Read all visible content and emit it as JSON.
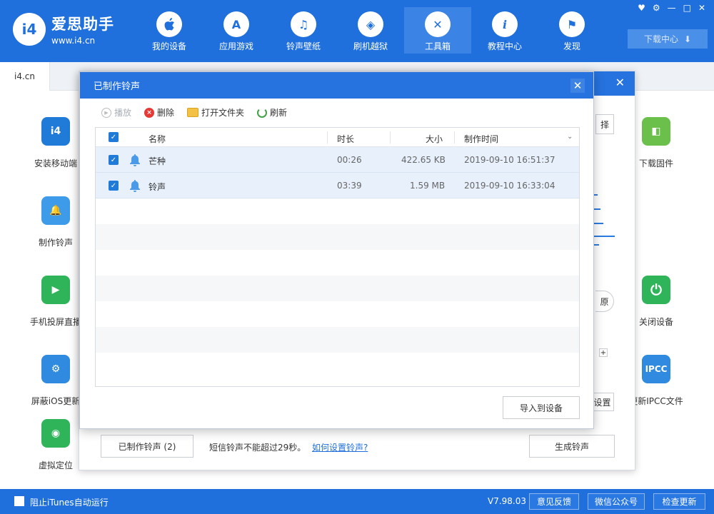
{
  "app": {
    "brand_name": "爱思助手",
    "brand_url": "www.i4.cn",
    "logo_mark": "i4"
  },
  "nav": [
    {
      "label": "我的设备",
      "icon": "apple-icon",
      "glyph": ""
    },
    {
      "label": "应用游戏",
      "icon": "app-store-icon",
      "glyph": "A"
    },
    {
      "label": "铃声壁纸",
      "icon": "music-icon",
      "glyph": "♫"
    },
    {
      "label": "刷机越狱",
      "icon": "dropbox-icon",
      "glyph": "◈"
    },
    {
      "label": "工具箱",
      "icon": "tools-icon",
      "glyph": "✕"
    },
    {
      "label": "教程中心",
      "icon": "info-icon",
      "glyph": "i"
    },
    {
      "label": "发现",
      "icon": "flag-icon",
      "glyph": "⚑"
    }
  ],
  "window_controls": [
    "♥",
    "⚙",
    "—",
    "□",
    "✕"
  ],
  "download_center": "下载中心",
  "tab": "i4.cn",
  "bg_tools_left": [
    {
      "label": "安装移动端",
      "glyph": "i4",
      "color": "#1f7ad8"
    },
    {
      "label": "制作铃声",
      "glyph": "🔔",
      "color": "#3d9be9"
    },
    {
      "label": "手机投屏直播",
      "glyph": "▶",
      "color": "#2fb45a"
    },
    {
      "label": "屏蔽iOS更新",
      "glyph": "⚙",
      "color": "#2f8ae0"
    },
    {
      "label": "虚拟定位",
      "glyph": "◉",
      "color": "#2fb45a"
    }
  ],
  "bg_tools_right": [
    {
      "label": "下载固件",
      "glyph": "◧",
      "color": "#6ac04a"
    },
    {
      "label": "关闭设备",
      "glyph": "⏻",
      "color": "#2fb45a"
    },
    {
      "label": "更新IPCC文件",
      "glyph": "IPCC",
      "color": "#2f8ae0"
    }
  ],
  "bg_dialog": {
    "made_button": "已制作铃声 (2)",
    "hint": "短信铃声不能超过29秒。",
    "hint_link": "如何设置铃声?",
    "generate_button": "生成铃声",
    "partial_select": "择",
    "partial_source": "原",
    "partial_settings": "设置",
    "plus": "+"
  },
  "dialog": {
    "title": "已制作铃声",
    "toolbar": {
      "play": "播放",
      "delete": "删除",
      "open_folder": "打开文件夹",
      "refresh": "刷新"
    },
    "columns": {
      "name": "名称",
      "duration": "时长",
      "size": "大小",
      "created": "制作时间"
    },
    "rows": [
      {
        "name": "芒种",
        "duration": "00:26",
        "size": "422.65 KB",
        "created": "2019-09-10 16:51:37",
        "checked": true
      },
      {
        "name": "铃声",
        "duration": "03:39",
        "size": "1.59 MB",
        "created": "2019-09-10 16:33:04",
        "checked": true
      }
    ],
    "import_button": "导入到设备"
  },
  "bottom": {
    "itunes_checkbox": "阻止iTunes自动运行",
    "version": "V7.98.03",
    "feedback": "意见反馈",
    "wechat": "微信公众号",
    "check_update": "检查更新"
  },
  "colors": {
    "primary": "#1f6fdc",
    "titlebar": "#2672de",
    "row_selected": "#e7f0fb"
  }
}
